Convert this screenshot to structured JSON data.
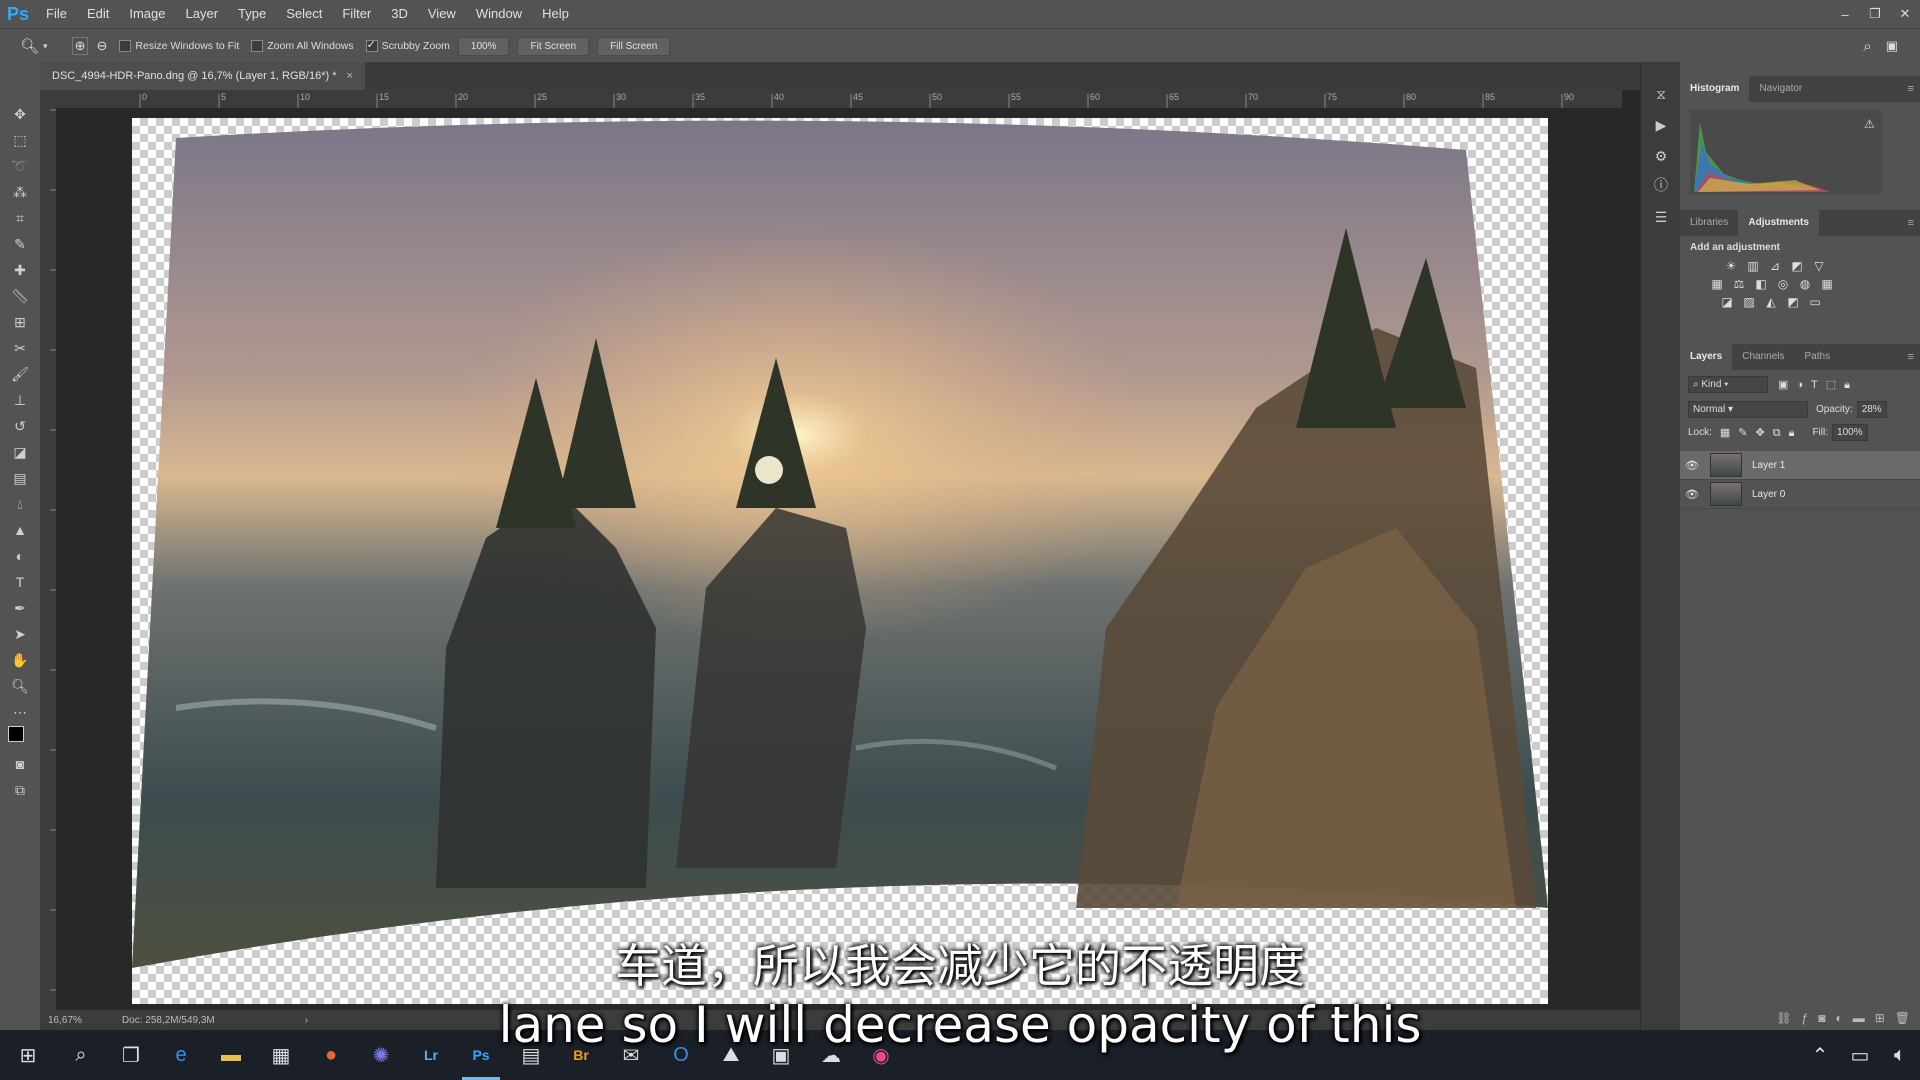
{
  "app": {
    "logo": "Ps"
  },
  "menu": [
    "File",
    "Edit",
    "Image",
    "Layer",
    "Type",
    "Select",
    "Filter",
    "3D",
    "View",
    "Window",
    "Help"
  ],
  "window_controls": [
    "–",
    "❐",
    "✕"
  ],
  "options": {
    "resize_windows": "Resize Windows to Fit",
    "zoom_all": "Zoom All Windows",
    "scrubby_zoom": "Scrubby Zoom",
    "zoom_pct": "100%",
    "fit_screen": "Fit Screen",
    "fill_screen": "Fill Screen"
  },
  "document": {
    "tab_title": "DSC_4994-HDR-Pano.dng @ 16,7% (Layer 1, RGB/16*) *",
    "zoom": "16,67%",
    "doc_info": "Doc: 258,2M/549,3M"
  },
  "ruler": {
    "ticks": [
      "0",
      "5",
      "10",
      "15",
      "20",
      "25",
      "30",
      "35",
      "40",
      "45",
      "50",
      "55",
      "60",
      "65",
      "70",
      "75",
      "80",
      "85",
      "90"
    ]
  },
  "panels": {
    "hist_tabs": [
      "Histogram",
      "Navigator"
    ],
    "adj_tabs": [
      "Libraries",
      "Adjustments"
    ],
    "add_adjustment": "Add an adjustment",
    "layer_tabs": [
      "Layers",
      "Channels",
      "Paths"
    ],
    "kind": "Kind",
    "blend_mode": "Normal",
    "opacity_label": "Opacity:",
    "opacity_value": "28%",
    "lock_label": "Lock:",
    "fill_label": "Fill:",
    "fill_value": "100%",
    "layers": [
      {
        "name": "Layer 1",
        "selected": true
      },
      {
        "name": "Layer 0",
        "selected": false
      }
    ]
  },
  "subtitles": {
    "chinese": "车道，所以我会减少它的不透明度",
    "english": "lane so I will decrease opacity of this"
  },
  "colors": {
    "ps_blue": "#31a8ff",
    "taskbar_accent": "#76b9ed"
  }
}
